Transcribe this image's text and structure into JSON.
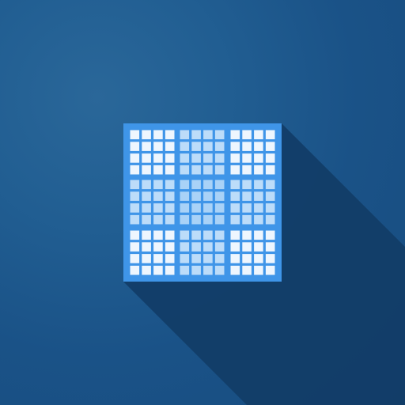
{
  "colors": {
    "background": "#1c5588",
    "shadow": "#123c66",
    "frame": "#3f95e8",
    "cell_light": "#eef6fe",
    "cell_tinted": "#bcdcf9",
    "cell_medium": "#a9d2f7"
  },
  "icon": {
    "name": "sudoku-grid-icon",
    "blocks": 9,
    "cells_per_block": 16,
    "block_tint": [
      "light",
      "tinted",
      "light",
      "tinted",
      "medium",
      "tinted",
      "light",
      "tinted",
      "light"
    ]
  }
}
